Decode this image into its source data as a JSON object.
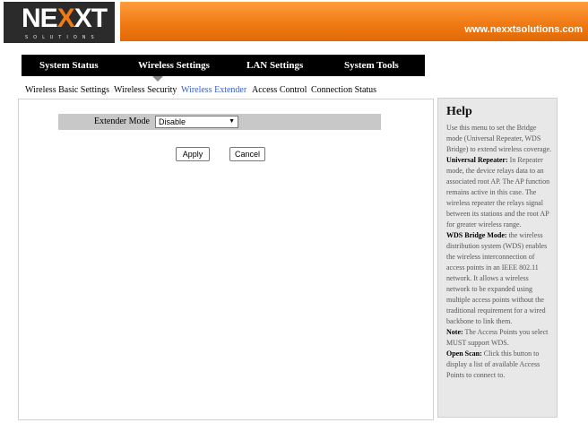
{
  "brand": {
    "logo_text_a": "NE",
    "logo_text_x": "X",
    "logo_text_b": "XT",
    "logo_sub": "SOLUTIONS",
    "url": "www.nexxtsolutions.com"
  },
  "colors": {
    "accent": "#f07a14",
    "nav_bg": "#000000",
    "active_link": "#3a5fc4",
    "help_bg": "#e8e8e8"
  },
  "main_nav": [
    {
      "label": "System Status"
    },
    {
      "label": "Wireless Settings"
    },
    {
      "label": "LAN Settings"
    },
    {
      "label": "System Tools"
    }
  ],
  "sub_nav": [
    {
      "label": "Wireless Basic Settings"
    },
    {
      "label": "Wireless Security"
    },
    {
      "label": "Wireless Extender"
    },
    {
      "label": "Access Control"
    },
    {
      "label": "Connection Status"
    }
  ],
  "form": {
    "extender_label": "Extender Mode",
    "extender_value": "Disable",
    "apply_label": "Apply",
    "cancel_label": "Cancel"
  },
  "help": {
    "title": "Help",
    "intro": "Use this menu to set the Bridge mode (Universal Repeater, WDS Bridge) to extend wireless coverage.",
    "repeater_heading": "Universal Repeater:",
    "repeater_text": " In Repeater mode, the device relays data to an associated root AP. The AP function remains active in this case. The wireless repeater the relays signal between its stations and the root AP for greater wireless range.",
    "wds_heading": "WDS Bridge Mode:",
    "wds_text": " the wireless distribution system (WDS) enables the wireless interconnection of access points in an IEEE 802.11 network. It allows a wireless network to be expanded using multiple access points without the traditional requirement for a wired backbone to link them.",
    "note_heading": "Note:",
    "note_text": " The Access Points you select MUST support WDS.",
    "scan_heading": "Open Scan:",
    "scan_text": " Click this button to display a list of available Access Points to connect to."
  }
}
